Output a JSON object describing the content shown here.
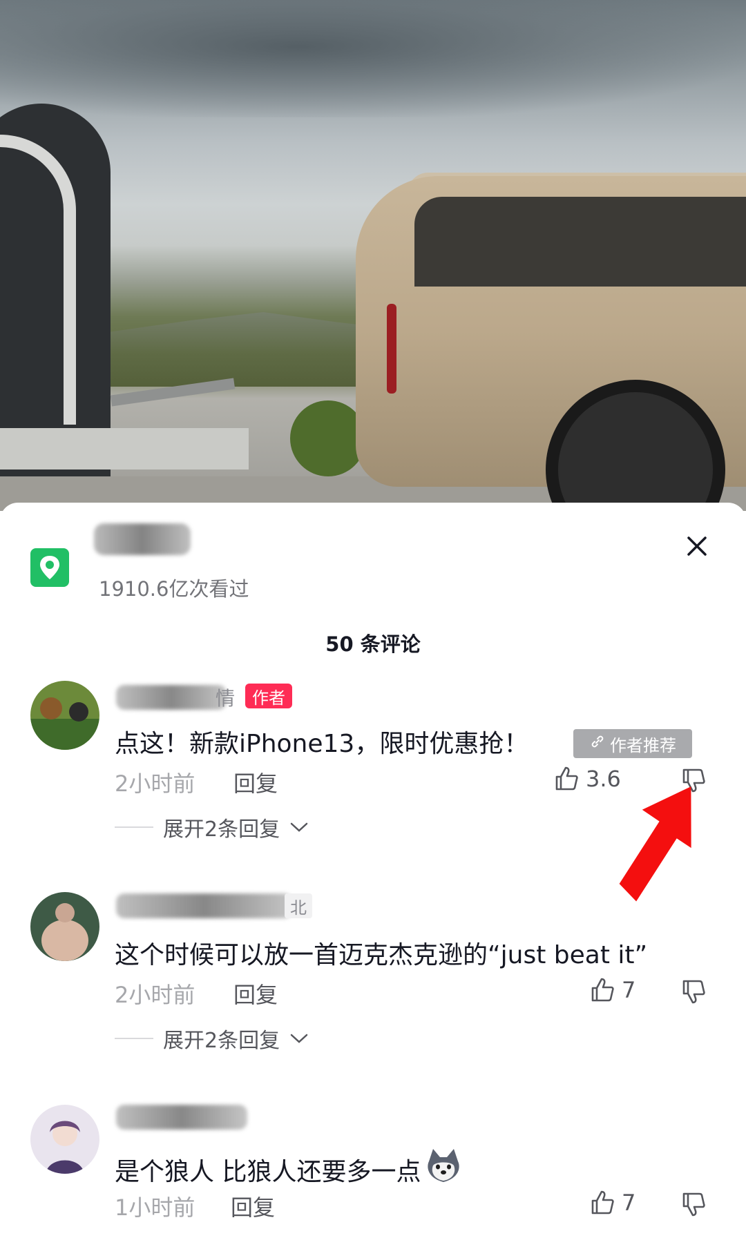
{
  "video": {
    "description_hidden": ""
  },
  "header": {
    "location_views": "1910.6亿次看过",
    "comment_count": "50 条评论"
  },
  "comments": [
    {
      "name_tail": "情",
      "author_badge": "作者",
      "text": "点这！新款iPhone13，限时优惠抢！",
      "pin_badge": "作者推荐",
      "time": "2小时前",
      "reply": "回复",
      "likes": "3.6",
      "expand": "展开2条回复"
    },
    {
      "region": "北",
      "text": "这个时候可以放一首迈克杰克逊的“just beat it”",
      "time": "2小时前",
      "reply": "回复",
      "likes": "7",
      "expand": "展开2条回复"
    },
    {
      "text": "是个狼人  比狼人还要多一点",
      "time": "1小时前",
      "reply": "回复",
      "likes": "7"
    }
  ],
  "colors": {
    "author_badge": "#fe2c55",
    "location_icon": "#21bf65",
    "arrow": "#f40f0f"
  }
}
